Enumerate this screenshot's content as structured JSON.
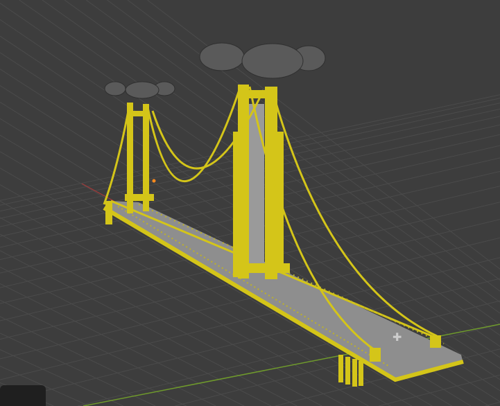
{
  "viewport": {
    "background_color": "#3d3d3d",
    "grid_color": "#4b4b4b",
    "x_axis_color": "#a23a3a",
    "y_axis_color": "#6f9a2c",
    "selection_color": "#d4c519",
    "dome_color": "#5a5a5a",
    "deck_color": "#8e8e8e",
    "object_icons": [
      "bridge-model",
      "origin-point",
      "light-icon"
    ]
  }
}
